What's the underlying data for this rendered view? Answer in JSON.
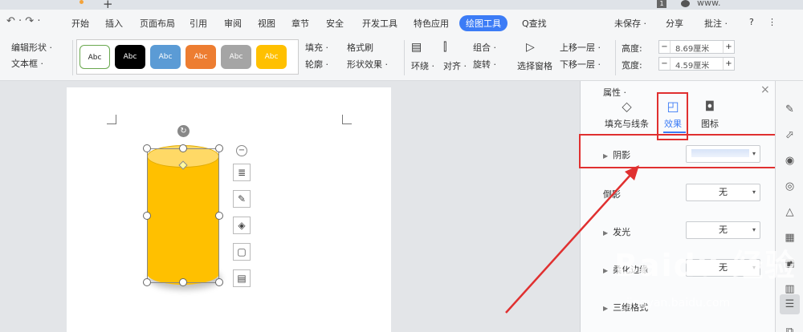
{
  "titlebar": {
    "new_tab": "+",
    "account_badge": "1",
    "site": "www."
  },
  "menu": {
    "undo": "↶ · ↷ ·",
    "items": [
      "开始",
      "插入",
      "页面布局",
      "引用",
      "审阅",
      "视图",
      "章节",
      "安全",
      "开发工具",
      "特色应用",
      "绘图工具",
      "Q查找"
    ],
    "right": {
      "save": "未保存 ·",
      "share": "分享",
      "comment": "批注 ·",
      "help": "?",
      "more": "⋮"
    }
  },
  "ribbon": {
    "edit_shape": "编辑形状 ·",
    "textbox": "文本框 ·",
    "styles": [
      "Abc",
      "Abc",
      "Abc",
      "Abc",
      "Abc",
      "Abc"
    ],
    "style_colors": [
      "#ffffff",
      "#000000",
      "#5b9bd5",
      "#ed7d31",
      "#a5a5a5",
      "#ffc000"
    ],
    "fill": "填充 ·",
    "format_painter": "格式刷",
    "outline": "轮廓 ·",
    "shape_effects": "形状效果 ·",
    "wrap": "环绕 ·",
    "align": "对齐 ·",
    "group": "组合 ·",
    "rotate": "旋转 ·",
    "selection_pane": "选择窗格",
    "bring_forward": "上移一层 ·",
    "send_backward": "下移一层 ·",
    "height_label": "高度:",
    "height_value": "8.69厘米",
    "width_label": "宽度:",
    "width_value": "4.59厘米"
  },
  "panel": {
    "title": "属性 ·",
    "tabs": [
      "填充与线条",
      "效果",
      "图标"
    ],
    "rows": [
      {
        "label": "阴影",
        "value": ""
      },
      {
        "label": "倒影",
        "value": "无"
      },
      {
        "label": "发光",
        "value": "无"
      },
      {
        "label": "柔化边缘",
        "value": "无"
      },
      {
        "label": "三维格式",
        "value": ""
      }
    ]
  },
  "watermark": {
    "main": "Baidu 经验",
    "sub": "jingyan.baidu.com"
  },
  "colors": {
    "accent": "#3c7cf6",
    "highlight_red": "#e03030",
    "shape_fill": "#ffc000"
  }
}
